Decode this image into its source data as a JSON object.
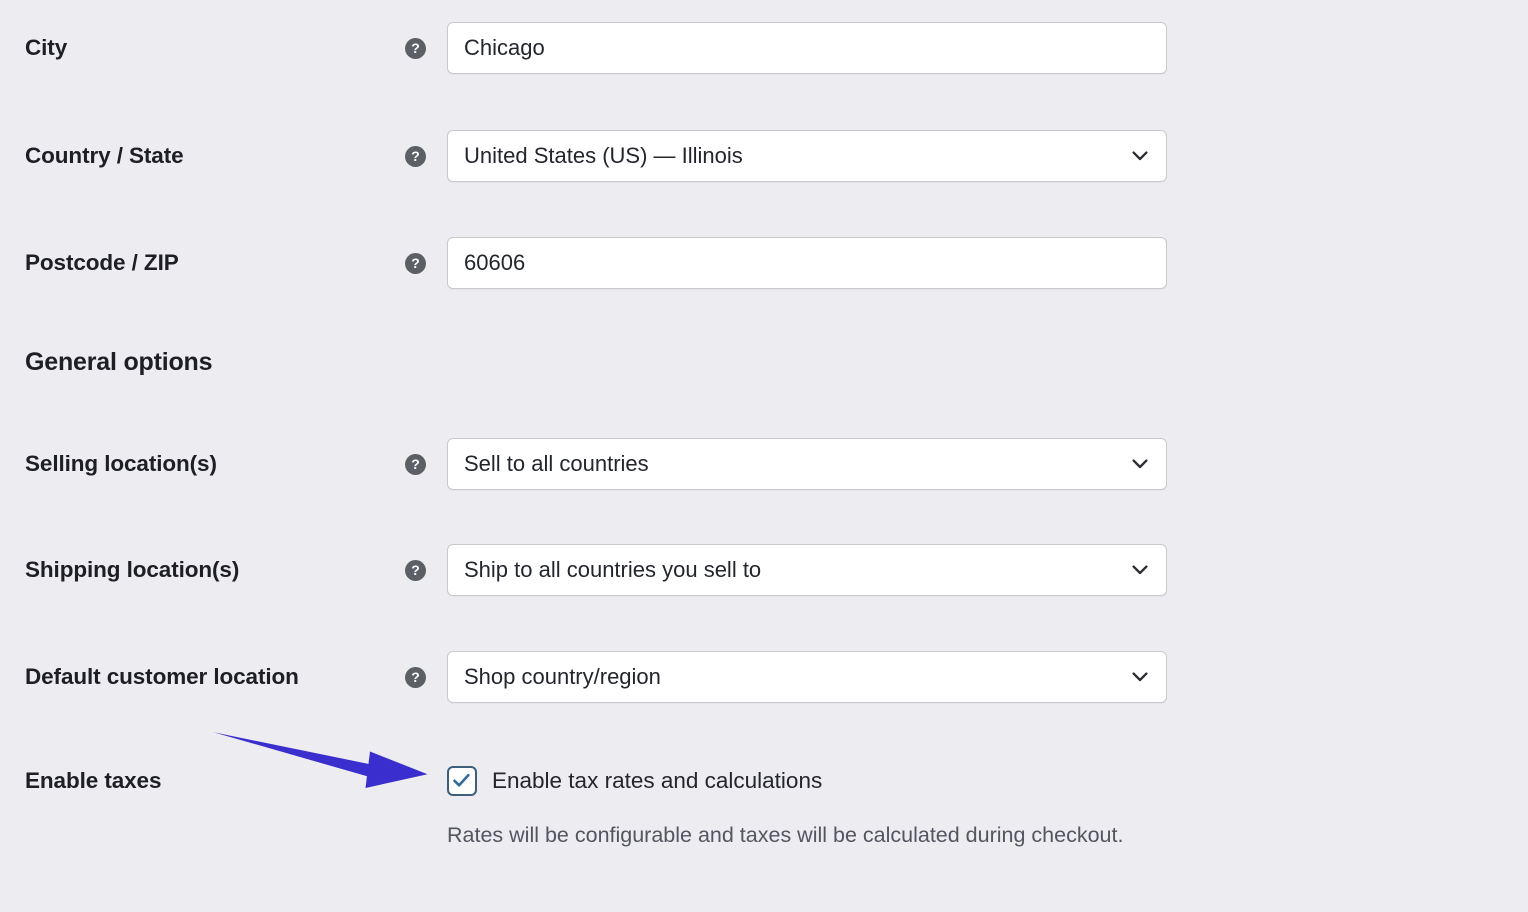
{
  "colors": {
    "background": "#edecf1",
    "field_background": "#ffffff",
    "field_border": "#c9c9ce",
    "label_text": "#1d1f24",
    "value_text": "#23262d",
    "description_text": "#53565e",
    "help_icon_background": "#5c5f66",
    "annotation_arrow": "#3a2fce",
    "checkbox_border": "#3d5f7a",
    "checkbox_check": "#2f6b9a"
  },
  "icons": {
    "help": "help-circle-icon",
    "chevron": "chevron-down-icon",
    "check": "check-icon",
    "arrow": "annotation-arrow-icon"
  },
  "help_glyph": "?",
  "rows": [
    {
      "label": "City",
      "type": "text",
      "value": "Chicago",
      "placeholder": "",
      "has_help": true
    },
    {
      "label": "Country / State",
      "type": "select",
      "value": "United States (US) — Illinois",
      "placeholder": "",
      "has_help": true
    },
    {
      "label": "Postcode / ZIP",
      "type": "text",
      "value": "60606",
      "placeholder": "",
      "has_help": true
    },
    {
      "label": "Selling location(s)",
      "type": "select",
      "value": "Sell to all countries",
      "placeholder": "",
      "has_help": true
    },
    {
      "label": "Shipping location(s)",
      "type": "select",
      "value": "Ship to all countries you sell to",
      "placeholder": "",
      "has_help": true
    },
    {
      "label": "Default customer location",
      "type": "select",
      "value": "Shop country/region",
      "placeholder": "",
      "has_help": true
    }
  ],
  "section": {
    "heading": "General options"
  },
  "enable_taxes": {
    "label": "Enable taxes",
    "checkbox_label": "Enable tax rates and calculations",
    "checked": true,
    "description": "Rates will be configurable and taxes will be calculated during checkout."
  }
}
